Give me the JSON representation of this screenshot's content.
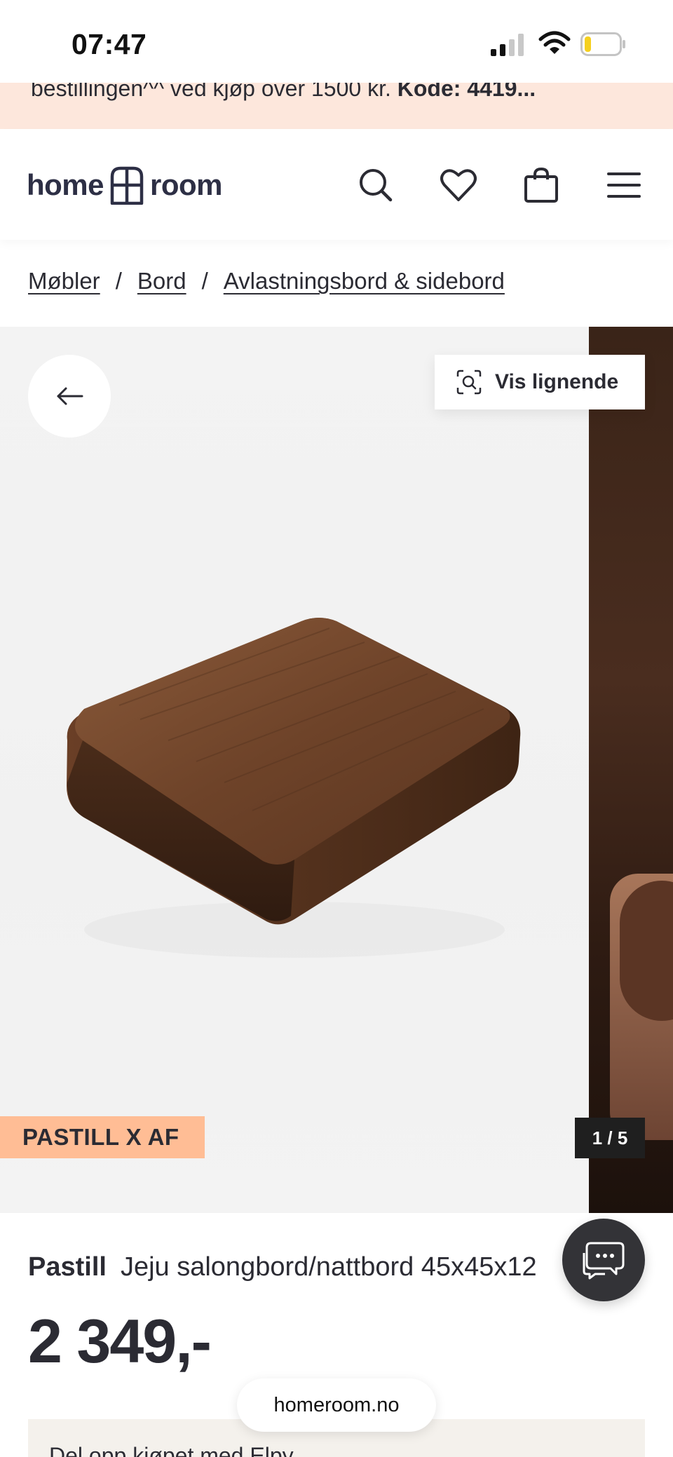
{
  "status_bar": {
    "time": "07:47"
  },
  "promo": {
    "text_prefix": "bestillingen^^ ved kjøp over 1500 kr.",
    "code_label": "Kode: 4419",
    "ellipsis": "..."
  },
  "header": {
    "logo_left": "home",
    "logo_right": "room",
    "icons": [
      "search-icon",
      "heart-icon",
      "bag-icon",
      "menu-icon"
    ]
  },
  "breadcrumb": {
    "items": [
      "Møbler",
      "Bord",
      "Avlastningsbord & sidebord"
    ],
    "separator": "/"
  },
  "gallery": {
    "similar_label": "Vis lignende",
    "brand_tag": "PASTILL X AF",
    "counter": "1 / 5"
  },
  "product": {
    "brand": "Pastill",
    "name": "Jeju salongbord/nattbord 45x45x12",
    "price": "2 349,-"
  },
  "financing": {
    "text": "Del opp kjøpet med Elpy"
  },
  "browser": {
    "url": "homeroom.no"
  },
  "colors": {
    "promo_bg": "#fde7dc",
    "brand_tag_bg": "#ffbd95",
    "text": "#2b2b33",
    "chat_bg": "#333337"
  }
}
